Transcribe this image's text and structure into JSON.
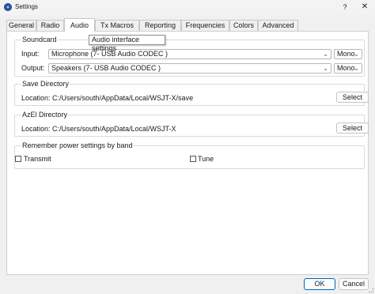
{
  "window": {
    "title": "Settings",
    "help_label": "?",
    "close_label": "✕"
  },
  "tabs": [
    {
      "label": "General"
    },
    {
      "label": "Radio"
    },
    {
      "label": "Audio",
      "active": true
    },
    {
      "label": "Tx Macros"
    },
    {
      "label": "Reporting"
    },
    {
      "label": "Frequencies"
    },
    {
      "label": "Colors"
    },
    {
      "label": "Advanced"
    }
  ],
  "tooltip": "Audio interface settings",
  "soundcard": {
    "title": "Soundcard",
    "input_label": "Input:",
    "input_value": "Microphone (7- USB Audio CODEC )",
    "input_channel": "Mono",
    "output_label": "Output:",
    "output_value": "Speakers (7- USB Audio CODEC )",
    "output_channel": "Mono"
  },
  "save_directory": {
    "title": "Save Directory",
    "location_label": "Location:",
    "path": "C:/Users/south/AppData/Local/WSJT-X/save",
    "select_label": "Select"
  },
  "azel_directory": {
    "title": "AzEl Directory",
    "location_label": "Location:",
    "path": "C:/Users/south/AppData/Local/WSJT-X",
    "select_label": "Select"
  },
  "power": {
    "title": "Remember power settings by band",
    "transmit_label": "Transmit",
    "transmit_checked": false,
    "tune_label": "Tune",
    "tune_checked": false
  },
  "footer": {
    "ok_label": "OK",
    "cancel_label": "Cancel"
  },
  "colors": {
    "accent": "#0067c0",
    "panel": "#ffffff",
    "window": "#f0f0f0"
  }
}
